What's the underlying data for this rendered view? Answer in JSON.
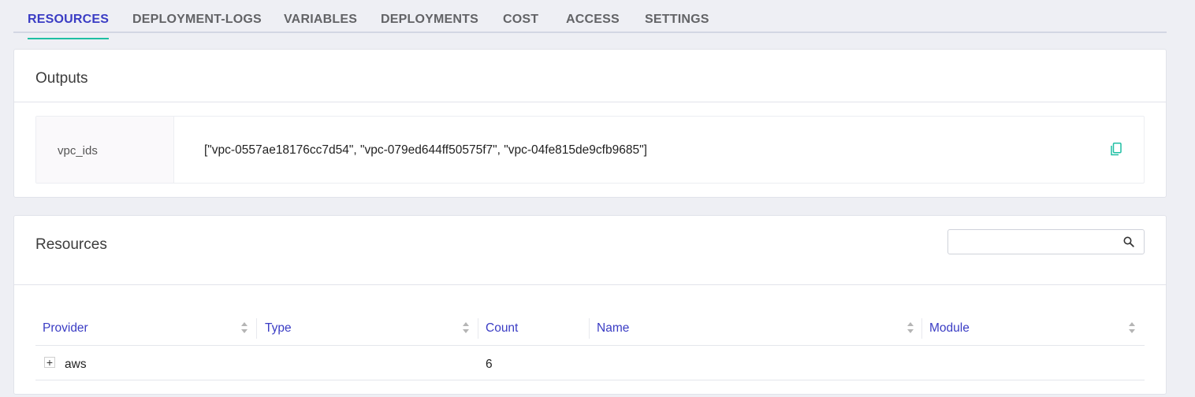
{
  "tabs": [
    {
      "label": "RESOURCES",
      "active": true
    },
    {
      "label": "DEPLOYMENT-LOGS",
      "active": false
    },
    {
      "label": "VARIABLES",
      "active": false
    },
    {
      "label": "DEPLOYMENTS",
      "active": false
    },
    {
      "label": "COST",
      "active": false
    },
    {
      "label": "ACCESS",
      "active": false
    },
    {
      "label": "SETTINGS",
      "active": false
    }
  ],
  "outputs": {
    "title": "Outputs",
    "items": [
      {
        "key": "vpc_ids",
        "value": "[\"vpc-0557ae18176cc7d54\", \"vpc-079ed644ff50575f7\", \"vpc-04fe815de9cfb9685\"]",
        "icon": "copy-icon"
      }
    ]
  },
  "resources": {
    "title": "Resources",
    "search": {
      "placeholder": "",
      "value": "",
      "icon": "search-icon"
    },
    "columns": [
      "Provider",
      "Type",
      "Count",
      "Name",
      "Module"
    ],
    "rows": [
      {
        "provider": "aws",
        "type": "",
        "count": "6",
        "name": "",
        "module": "",
        "expand_symbol": "+"
      }
    ]
  },
  "colors": {
    "accent": "#3a3cc4",
    "tab_indicator": "#1fbfa3",
    "copy_icon": "#1fbfa3"
  }
}
